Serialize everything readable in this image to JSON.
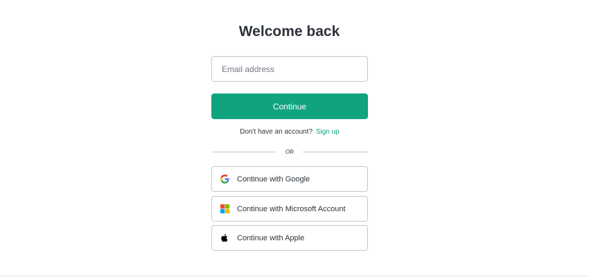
{
  "title": "Welcome back",
  "email": {
    "placeholder": "Email address",
    "value": ""
  },
  "continue_label": "Continue",
  "signup": {
    "prompt": "Don't have an account?",
    "link_label": "Sign up"
  },
  "divider_label": "OR",
  "social": {
    "google": {
      "label": "Continue with Google",
      "icon": "google-icon"
    },
    "microsoft": {
      "label": "Continue with Microsoft Account",
      "icon": "microsoft-icon"
    },
    "apple": {
      "label": "Continue with Apple",
      "icon": "apple-icon"
    }
  },
  "colors": {
    "accent": "#10a37f",
    "text": "#2d333a",
    "border": "#c2c8d0"
  }
}
